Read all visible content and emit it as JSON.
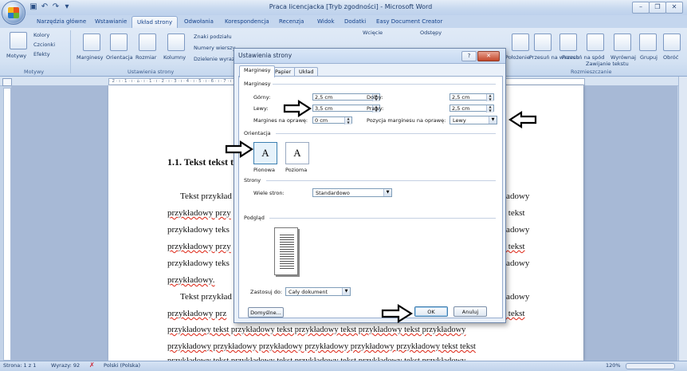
{
  "window": {
    "title": "Praca licencjacka [Tryb zgodności] - Microsoft Word",
    "minimize_symbol": "–",
    "maximize_symbol": "❐",
    "close_symbol": "✕"
  },
  "qat": {
    "save_icon": "save-icon",
    "undo_icon": "undo-icon",
    "redo_icon": "redo-icon"
  },
  "ribbon_tabs": [
    {
      "label": "Narzędzia główne"
    },
    {
      "label": "Wstawianie"
    },
    {
      "label": "Układ strony"
    },
    {
      "label": "Odwołania"
    },
    {
      "label": "Korespondencja"
    },
    {
      "label": "Recenzja"
    },
    {
      "label": "Widok"
    },
    {
      "label": "Dodatki"
    },
    {
      "label": "Easy Document Creator"
    }
  ],
  "ribbon": {
    "motywy": {
      "big_label": "Motywy",
      "kolory": "Kolory",
      "czcionki": "Czcionki",
      "efekty": "Efekty",
      "group": "Motywy"
    },
    "ustawienia": {
      "marginesy": "Marginesy",
      "orientacja": "Orientacja",
      "rozmiar": "Rozmiar",
      "kolumny": "Kolumny",
      "znaki_podzialu": "Znaki podziału",
      "numery_wierszy": "Numery wierszy",
      "dzielenie": "Dzielenie wyrazów",
      "group": "Ustawienia strony"
    },
    "wciecie": "Wcięcie",
    "odstepy": "Odstępy",
    "rozmieszczanie": {
      "items": [
        "Położenie",
        "Przesuń na wierzch",
        "Przesuń na spód",
        "Zawijanie tekstu",
        "Wyrównaj",
        "Grupuj",
        "Obróć"
      ],
      "group": "Rozmieszczanie"
    }
  },
  "ruler_text": "· 2 · ı · 1 · ı · ⌂ · ı · 1 · ı · 2 · ı · 3 · ı · 4 · ı · 5 · ı · 6 · ı · 7 · ı · 8 · ı · 9 · ı · 10 · ı · 11 · ı · 12 · ı · 13 · ı · 14 · ı · 15 · ı · △ · ı · 17 · ı · 18 ·",
  "document": {
    "heading": "1.1. Tekst tekst te",
    "left_lines": [
      "Tekst przykład",
      "przykładowy przy",
      "przykładowy teks",
      "przykładowy przy",
      "przykładowy teks",
      "przykładowy.",
      "Tekst przykład",
      "przykładowy prz"
    ],
    "right_lines": [
      "ładowy",
      "t tekst",
      "ładowy",
      "t tekst",
      "ładowy",
      "",
      "ładowy",
      "t tekst"
    ],
    "full_lines": [
      "przykładowy tekst przykładowy tekst przykładowy tekst przykładowy tekst przykładowy",
      "przykładowy przykładowy przykładowy przykładowy przykładowy przykładowy tekst tekst",
      "przykładowy tekst przykładowy tekst przykładowy tekst przykładowy tekst przykładowy"
    ]
  },
  "dialog": {
    "title": "Ustawienia strony",
    "help": "?",
    "close": "✕",
    "tabs": [
      "Marginesy",
      "Papier",
      "Układ"
    ],
    "margins_section": "Marginesy",
    "gorny_label": "Górny:",
    "gorny_value": "2,5 cm",
    "dolny_label": "Dolny:",
    "dolny_value": "2,5 cm",
    "lewy_label": "Lewy:",
    "lewy_value": "3,5 cm",
    "prawy_label": "Prawy:",
    "prawy_value": "2,5 cm",
    "oprawa_label": "Margines na oprawę:",
    "oprawa_value": "0 cm",
    "pozycja_label": "Pozycja marginesu na oprawę:",
    "pozycja_value": "Lewy",
    "orientation_section": "Orientacja",
    "pionowa": "Pionowa",
    "pozioma": "Pozioma",
    "pages_section": "Strony",
    "wiele_label": "Wiele stron:",
    "wiele_value": "Standardowo",
    "preview_section": "Podgląd",
    "apply_label": "Zastosuj do:",
    "apply_value": "Cały dokument",
    "default_btn": "Domyślne...",
    "ok_btn": "OK",
    "cancel_btn": "Anuluj"
  },
  "status": {
    "page": "Strona: 1 z 1",
    "words": "Wyrazy: 92",
    "lang": "Polski (Polska)",
    "zoom": "120%"
  }
}
